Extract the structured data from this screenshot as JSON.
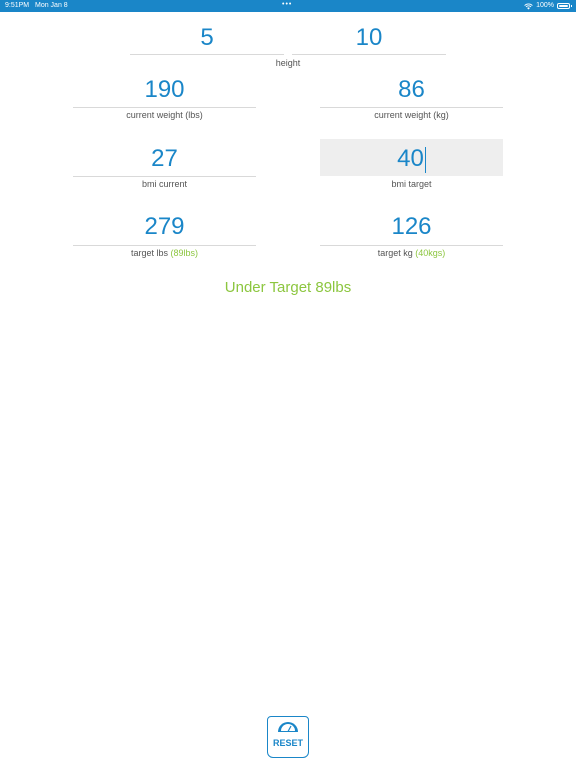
{
  "status_bar": {
    "time": "9:51PM",
    "date": "Mon Jan 8",
    "dots": "•••",
    "battery": "100%"
  },
  "height": {
    "feet": "5",
    "inches": "10",
    "label": "height"
  },
  "current_weight": {
    "lbs": "190",
    "lbs_label": "current weight (lbs)",
    "kg": "86",
    "kg_label": "current weight (kg)"
  },
  "bmi": {
    "current": "27",
    "current_label": "bmi current",
    "target": "40",
    "target_label": "bmi target"
  },
  "target": {
    "lbs": "279",
    "lbs_label": "target lbs",
    "lbs_diff": "(89lbs)",
    "kg": "126",
    "kg_label": "target kg",
    "kg_diff": "(40kgs)"
  },
  "result": "Under Target 89lbs",
  "reset_label": "RESET",
  "colors": {
    "accent": "#1a86c8",
    "positive": "#8cc63f"
  }
}
